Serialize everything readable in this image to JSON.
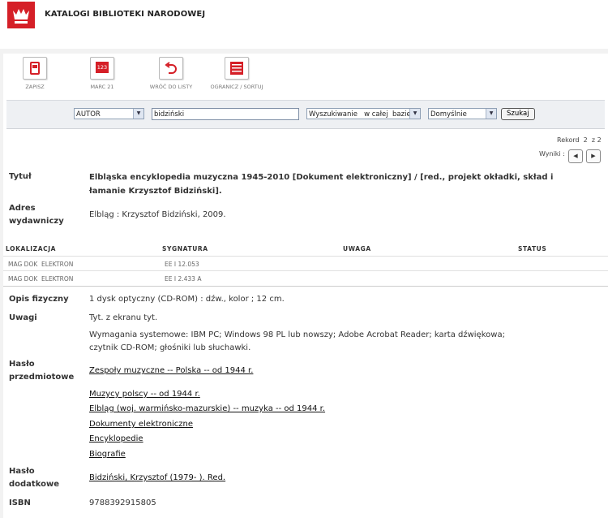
{
  "header": {
    "title": "KATALOGI BIBLIOTEKI NARODOWEJ"
  },
  "toolbar": [
    {
      "icon": "save-icon",
      "label": "ZAPISZ"
    },
    {
      "icon": "marc21-icon",
      "label": "MARC 21",
      "icon_text": "123"
    },
    {
      "icon": "back-arrow-icon",
      "label": "WRÓĆ DO LISTY"
    },
    {
      "icon": "list-filter-icon",
      "label": "OGRANICZ / SORTUJ"
    }
  ],
  "search": {
    "field": "AUTOR",
    "query": "bidziński",
    "scope": "Wyszukiwanie   w całej  bazie",
    "sort": "Domyślnie",
    "submit": "Szukaj"
  },
  "record": {
    "counter": "Rekord  2  z 2",
    "results_label": "Wyniki :"
  },
  "fields": {
    "title_label": "Tytuł",
    "title_value": "Elbląska encyklopedia muzyczna 1945-2010 [Dokument elektroniczny] / [red., projekt okładki, skład i łamanie Krzysztof Bidziński].",
    "publisher_label": "Adres wydawniczy",
    "publisher_value": "Elbląg : Krzysztof Bidziński, 2009.",
    "physical_label": "Opis fizyczny",
    "physical_value": "1 dysk optyczny (CD-ROM) : dźw., kolor ; 12 cm.",
    "notes_label": "Uwagi",
    "notes": [
      "Tyt. z ekranu tyt.",
      "Wymagania systemowe: IBM PC; Windows 98 PL lub nowszy; Adobe Acrobat Reader; karta dźwiękowa; czytnik CD-ROM; głośniki lub słuchawki."
    ],
    "subject_label": "Hasło przedmiotowe",
    "subjects": [
      "Zespoły muzyczne -- Polska -- od 1944 r.",
      "Muzycy polscy -- od 1944 r.",
      "Elbląg (woj. warmińsko-mazurskie) -- muzyka -- od 1944 r.",
      "Dokumenty elektroniczne",
      "Encyklopedie",
      "Biografie"
    ],
    "added_label": "Hasło dodatkowe",
    "added_value": "Bidziński, Krzysztof (1979- ). Red.",
    "isbn_label": "ISBN",
    "isbn_value": "9788392915805"
  },
  "holdings": {
    "headers": [
      "LOKALIZACJA",
      "SYGNATURA",
      "UWAGA",
      "STATUS"
    ],
    "rows": [
      {
        "location": "MAG DOK  ELEKTRON",
        "signature": "EE I 12.053"
      },
      {
        "location": "MAG DOK  ELEKTRON",
        "signature": "EE I 2.433 A"
      }
    ]
  }
}
